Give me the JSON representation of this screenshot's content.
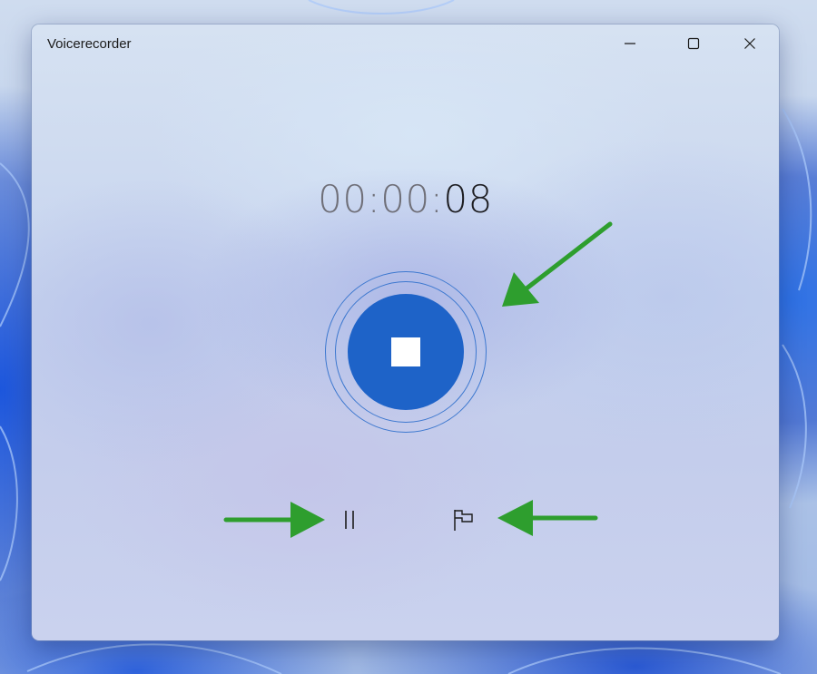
{
  "window": {
    "title": "Voicerecorder",
    "controls": {
      "minimize_icon": "minimize-icon",
      "maximize_icon": "maximize-icon",
      "close_icon": "close-icon"
    }
  },
  "recorder": {
    "timer_muted": "00:00:",
    "timer_active": "08",
    "stop_icon": "stop-icon",
    "pause_icon": "pause-icon",
    "marker_icon": "flag-icon"
  },
  "annotations": {
    "arrow_color": "#2e9e2e",
    "count": 3
  },
  "colors": {
    "accent": "#1e63c8",
    "ring": "#3d78cf",
    "timer_muted": "#6f6f78",
    "timer_active": "#1e1e22"
  }
}
